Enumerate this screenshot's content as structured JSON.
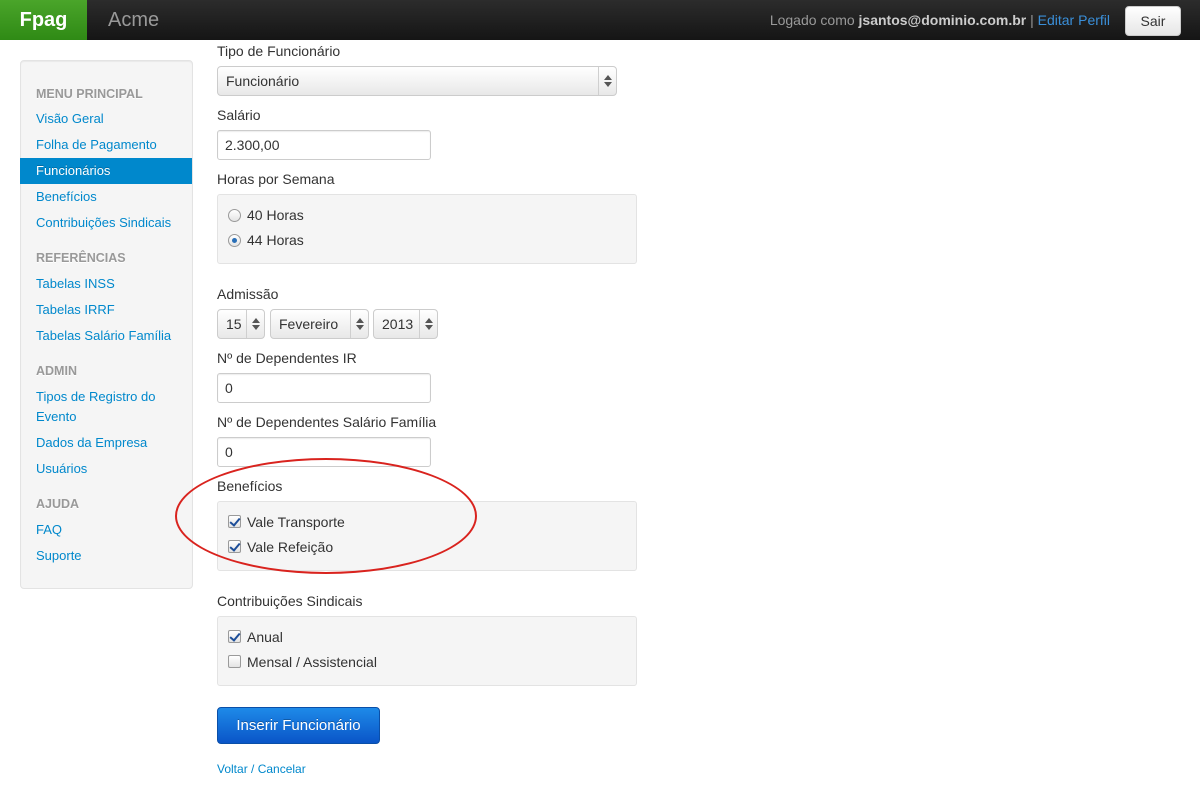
{
  "navbar": {
    "brand": "Fpag",
    "company": "Acme",
    "logged_prefix": "Logado como ",
    "user": "jsantos@dominio.com.br",
    "separator": " | ",
    "edit_profile": "Editar Perfil",
    "logout": "Sair"
  },
  "sidebar": {
    "sections": [
      {
        "header": "MENU PRINCIPAL",
        "items": [
          "Visão Geral",
          "Folha de Pagamento",
          "Funcionários",
          "Benefícios",
          "Contribuições Sindicais"
        ]
      },
      {
        "header": "REFERÊNCIAS",
        "items": [
          "Tabelas INSS",
          "Tabelas IRRF",
          "Tabelas Salário Família"
        ]
      },
      {
        "header": "ADMIN",
        "items": [
          "Tipos de Registro do Evento",
          "Dados da Empresa",
          "Usuários"
        ]
      },
      {
        "header": "AJUDA",
        "items": [
          "FAQ",
          "Suporte"
        ]
      }
    ],
    "active_item": "Funcionários"
  },
  "form": {
    "tipo": {
      "label": "Tipo de Funcionário",
      "value": "Funcionário"
    },
    "salario": {
      "label": "Salário",
      "value": "2.300,00"
    },
    "horas": {
      "label": "Horas por Semana",
      "options": [
        {
          "label": "40 Horas",
          "checked": false
        },
        {
          "label": "44 Horas",
          "checked": true
        }
      ]
    },
    "admissao": {
      "label": "Admissão",
      "day": "15",
      "month": "Fevereiro",
      "year": "2013"
    },
    "dep_ir": {
      "label": "Nº de Dependentes IR",
      "value": "0"
    },
    "dep_sf": {
      "label": "Nº de Dependentes Salário Família",
      "value": "0"
    },
    "beneficios": {
      "label": "Benefícios",
      "options": [
        {
          "label": "Vale Transporte",
          "checked": true
        },
        {
          "label": "Vale Refeição",
          "checked": true
        }
      ]
    },
    "contribuicoes": {
      "label": "Contribuições Sindicais",
      "options": [
        {
          "label": "Anual",
          "checked": true
        },
        {
          "label": "Mensal / Assistencial",
          "checked": false
        }
      ]
    },
    "submit": "Inserir Funcionário",
    "cancel": "Voltar / Cancelar"
  },
  "colors": {
    "brand_green": "#3c9a1f",
    "link_blue": "#0088cc",
    "primary_button": "#0a55c8",
    "highlight_red": "#d9231e"
  }
}
